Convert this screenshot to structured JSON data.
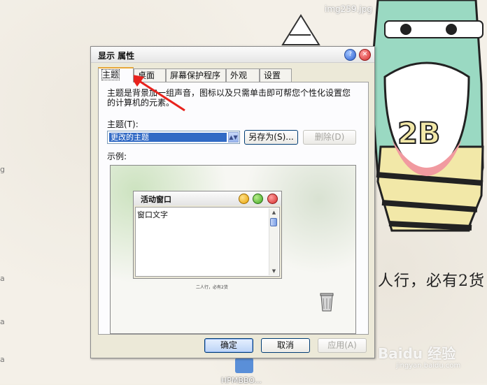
{
  "desktop": {
    "caption": "img259.jpg",
    "hand_text": "人行，必有2货",
    "left_fragments": [
      "g",
      "a",
      "a",
      "a"
    ],
    "bottom_icon_label": "HPMBBO...",
    "watermark": "Baidu 经验",
    "watermark_sub": "jingyan.baidu.com"
  },
  "dialog": {
    "title": "显示 属性",
    "tabs": [
      {
        "label": "主题",
        "active": true
      },
      {
        "label": "桌面",
        "active": false
      },
      {
        "label": "屏幕保护程序",
        "active": false
      },
      {
        "label": "外观",
        "active": false
      },
      {
        "label": "设置",
        "active": false
      }
    ],
    "description": "主题是背景加一组声音，图标以及只需单击即可帮您个性化设置您的计算机的元素。",
    "theme_label": "主题(T):",
    "theme_value": "更改的主题",
    "save_as_label": "另存为(S)...",
    "delete_label": "删除(D)",
    "preview_label": "示例:",
    "preview_window_title": "活动窗口",
    "preview_window_text": "窗口文字",
    "preview_tiny_text": "二人行，必有2货",
    "ok_label": "确定",
    "cancel_label": "取消",
    "apply_label": "应用(A)"
  },
  "annotation": {
    "color": "#e8231d"
  }
}
